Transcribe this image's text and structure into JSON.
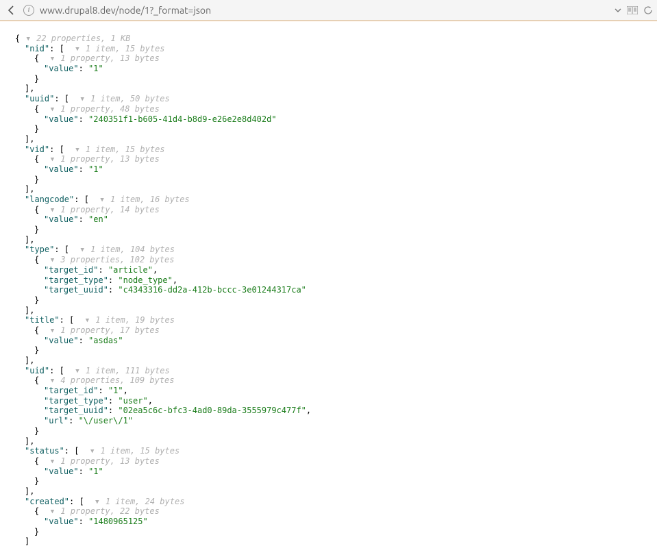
{
  "url": "www.drupal8.dev/node/1?_format=json",
  "root_meta": "22 properties, 1 KB",
  "fields": {
    "nid": {
      "arr_meta": "1 item, 15 bytes",
      "obj_meta": "1 property, 13 bytes",
      "props": [
        [
          "value",
          "1"
        ]
      ]
    },
    "uuid": {
      "arr_meta": "1 item, 50 bytes",
      "obj_meta": "1 property, 48 bytes",
      "props": [
        [
          "value",
          "240351f1-b605-41d4-b8d9-e26e2e8d402d"
        ]
      ]
    },
    "vid": {
      "arr_meta": "1 item, 15 bytes",
      "obj_meta": "1 property, 13 bytes",
      "props": [
        [
          "value",
          "1"
        ]
      ]
    },
    "langcode": {
      "arr_meta": "1 item, 16 bytes",
      "obj_meta": "1 property, 14 bytes",
      "props": [
        [
          "value",
          "en"
        ]
      ]
    },
    "type": {
      "arr_meta": "1 item, 104 bytes",
      "obj_meta": "3 properties, 102 bytes",
      "props": [
        [
          "target_id",
          "article"
        ],
        [
          "target_type",
          "node_type"
        ],
        [
          "target_uuid",
          "c4343316-dd2a-412b-bccc-3e01244317ca"
        ]
      ]
    },
    "title": {
      "arr_meta": "1 item, 19 bytes",
      "obj_meta": "1 property, 17 bytes",
      "props": [
        [
          "value",
          "asdas"
        ]
      ]
    },
    "uid": {
      "arr_meta": "1 item, 111 bytes",
      "obj_meta": "4 properties, 109 bytes",
      "props": [
        [
          "target_id",
          "1"
        ],
        [
          "target_type",
          "user"
        ],
        [
          "target_uuid",
          "02ea5c6c-bfc3-4ad0-89da-3555979c477f"
        ],
        [
          "url",
          "\\/user\\/1"
        ]
      ]
    },
    "status": {
      "arr_meta": "1 item, 15 bytes",
      "obj_meta": "1 property, 13 bytes",
      "props": [
        [
          "value",
          "1"
        ]
      ]
    },
    "created": {
      "arr_meta": "1 item, 24 bytes",
      "obj_meta": "1 property, 22 bytes",
      "props": [
        [
          "value",
          "1480965125"
        ]
      ]
    }
  },
  "order": [
    "nid",
    "uuid",
    "vid",
    "langcode",
    "type",
    "title",
    "uid",
    "status",
    "created"
  ]
}
